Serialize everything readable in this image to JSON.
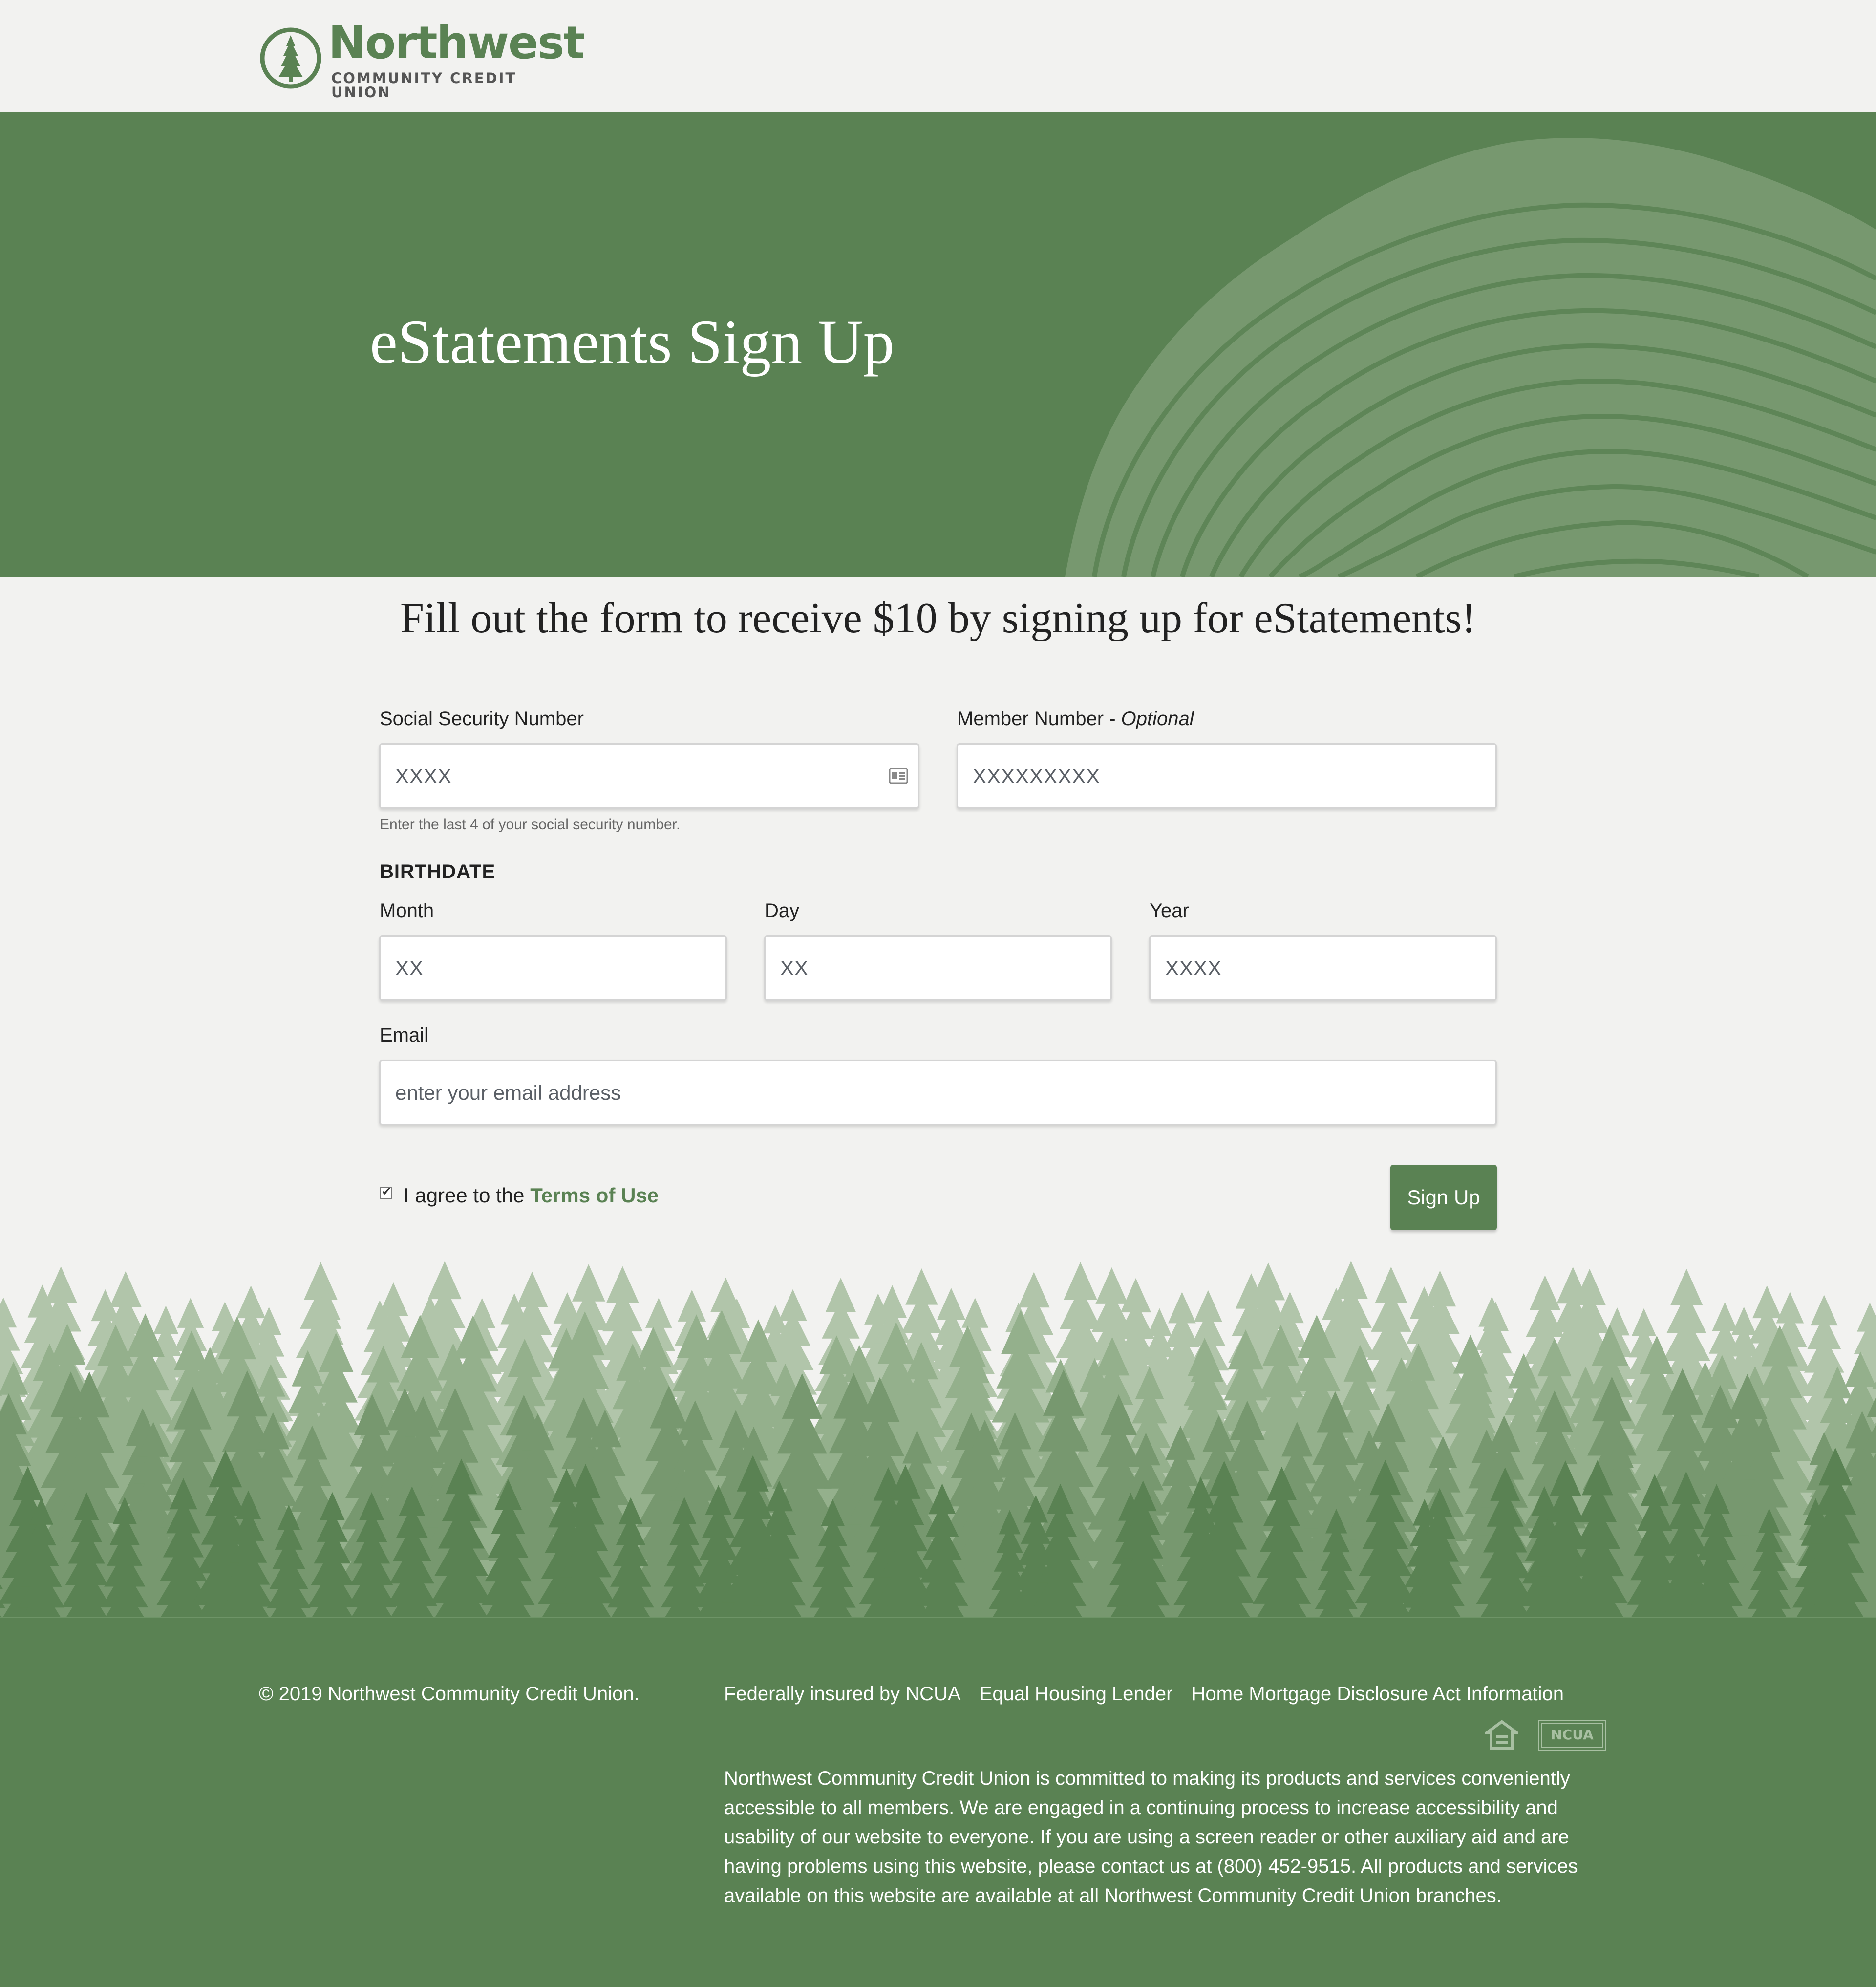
{
  "brand": {
    "name": "Northwest",
    "tm": "™",
    "subtitle": "COMMUNITY CREDIT UNION",
    "color": "#5a8253"
  },
  "hero": {
    "title": "eStatements Sign Up"
  },
  "intro": "Fill out the form to receive $10 by signing up for eStatements!",
  "form": {
    "ssn": {
      "label": "Social Security Number",
      "placeholder": "XXXX",
      "help": "Enter the last 4 of your social security number.",
      "icon": "id-card-icon"
    },
    "member": {
      "label": "Member Number - ",
      "label_optional": "Optional",
      "placeholder": "XXXXXXXXX"
    },
    "birthdate": {
      "title": "BIRTHDATE",
      "month": {
        "label": "Month",
        "placeholder": "XX"
      },
      "day": {
        "label": "Day",
        "placeholder": "XX"
      },
      "year": {
        "label": "Year",
        "placeholder": "XXXX"
      }
    },
    "email": {
      "label": "Email",
      "placeholder": "enter your email address"
    },
    "terms": {
      "checked": true,
      "prefix": "I agree to the ",
      "link": "Terms of Use"
    },
    "submit": "Sign Up"
  },
  "footer": {
    "copyright": "© 2019 Northwest Community Credit Union.",
    "links": [
      "Federally insured by NCUA",
      "Equal Housing Lender",
      "Home Mortgage Disclosure Act Information"
    ],
    "badges": {
      "equal_housing": "equal-housing-icon",
      "ncua": "NCUA"
    },
    "accessibility": "Northwest Community Credit Union is committed to making its products and services conveniently accessible to all members. We are engaged in a continuing process to increase accessibility and usability of our website to everyone. If you are using a screen reader or other auxiliary aid and are having problems using this website, please contact us at (800) 452-9515. All products and services available on this website are available at all Northwest Community Credit Union branches."
  }
}
